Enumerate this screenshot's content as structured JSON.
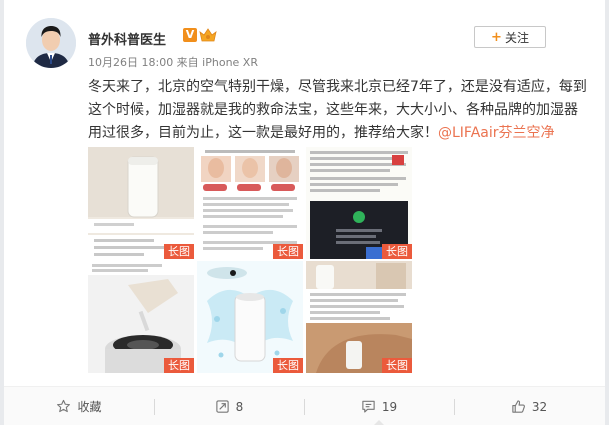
{
  "author": {
    "name": "普外科普医生",
    "verified_mark": "V"
  },
  "follow_button": {
    "label": "关注"
  },
  "post": {
    "meta": "10月26日 18:00 来自 iPhone XR",
    "text_main": "冬天来了，北京的空气特别干燥，尽管我来北京已经7年了，还是没有适应，每到这个时候，加湿器就是我的救命法宝，这些年来，大大小小、各种品牌的加湿器用过很多，目前为止，这一款是最好用的，推荐给大家！",
    "text_link": "@LIFAair芬兰空净"
  },
  "thumbnails": [
    {
      "tag": "长图",
      "icon": "humidifier-photo"
    },
    {
      "tag": "长图",
      "icon": "faces-article"
    },
    {
      "tag": "长图",
      "icon": "text-article"
    },
    {
      "tag": "长图",
      "icon": "humidifier-top"
    },
    {
      "tag": "长图",
      "icon": "humidifier-splash"
    },
    {
      "tag": "长图",
      "icon": "humidifier-room"
    }
  ],
  "actions": {
    "favorite": "收藏",
    "repost": "8",
    "comment": "19",
    "like": "32"
  },
  "colors": {
    "link": "#eb7350",
    "tag_bg": "#eb5a3c",
    "verified": "#f18f1c"
  }
}
